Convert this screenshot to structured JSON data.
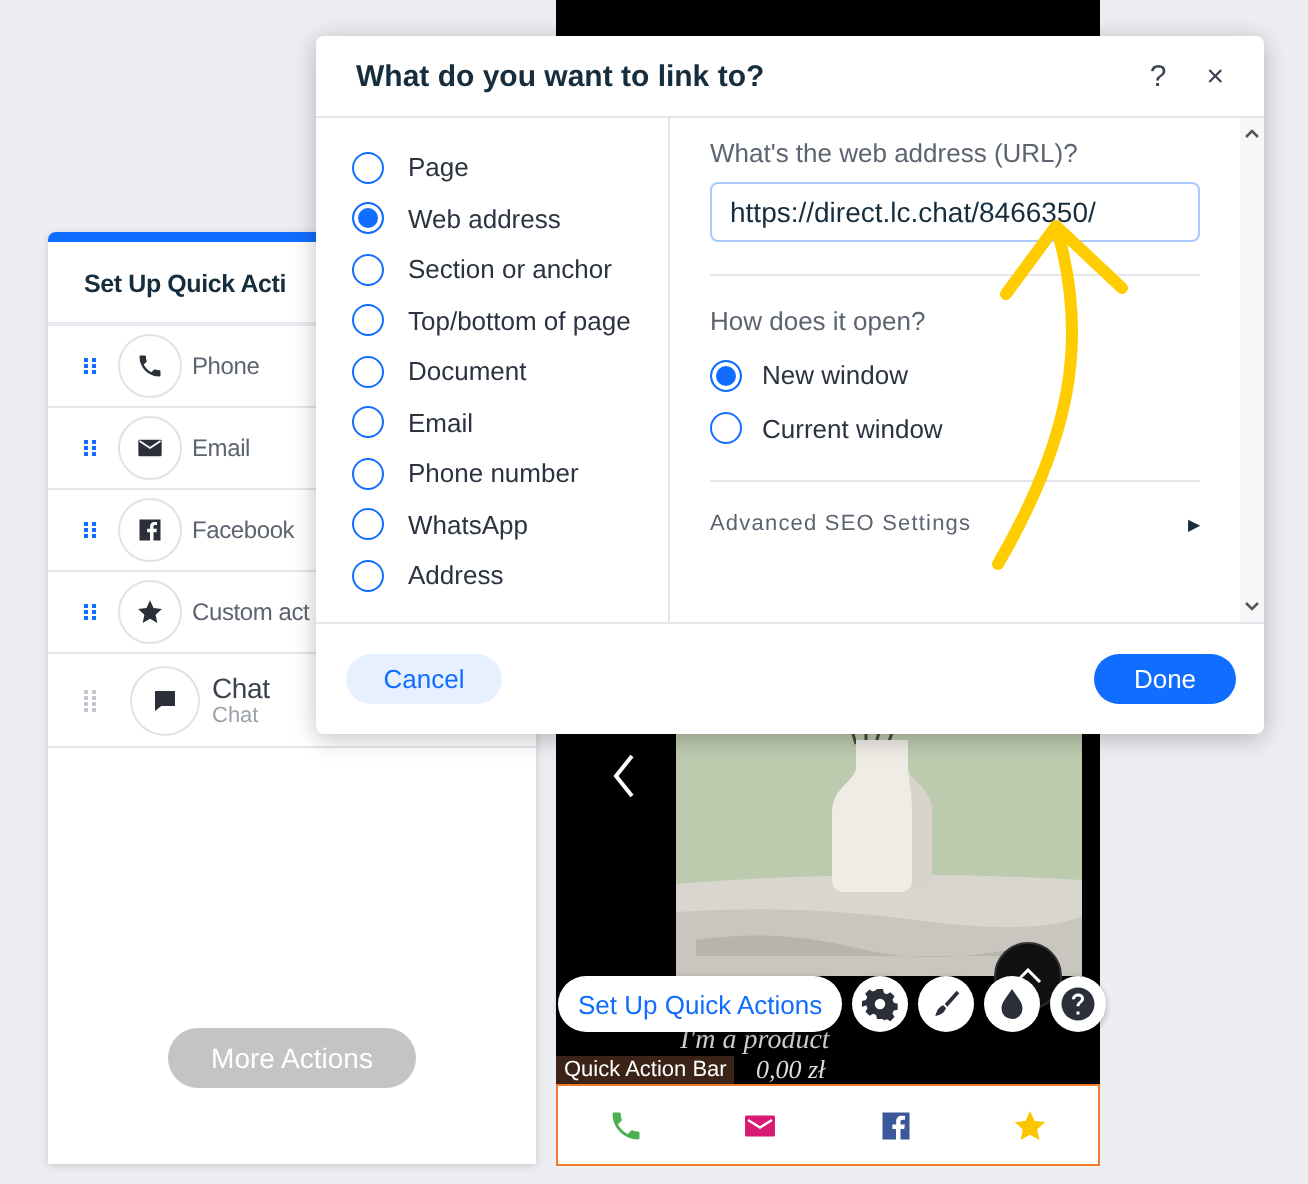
{
  "quick_actions_panel": {
    "title": "Set Up Quick Acti",
    "items": [
      {
        "kind": "phone",
        "label": "Phone",
        "active": true
      },
      {
        "kind": "email",
        "label": "Email",
        "active": true
      },
      {
        "kind": "facebook",
        "label": "Facebook",
        "active": true
      },
      {
        "kind": "star",
        "label": "Custom act",
        "active": true
      },
      {
        "kind": "chat",
        "label": "Chat",
        "subtitle": "Chat",
        "active": false
      }
    ],
    "more_button": {
      "label": "More Actions",
      "disabled": true
    }
  },
  "preview": {
    "product_title": "I'm a product",
    "price": "0,00 zł",
    "toolbar_button": "Set Up Quick Actions",
    "toolbar_icons": [
      {
        "kind": "gear"
      },
      {
        "kind": "brush"
      },
      {
        "kind": "drop"
      },
      {
        "kind": "help"
      }
    ],
    "bar_label": "Quick Action Bar",
    "bar_icons": [
      {
        "kind": "phone",
        "color": "#4caf50"
      },
      {
        "kind": "email",
        "color": "#d81b72"
      },
      {
        "kind": "facebook",
        "color": "#3b5998"
      },
      {
        "kind": "star",
        "color": "#fbc600"
      }
    ]
  },
  "dialog": {
    "title": "What do you want to link to?",
    "help": "?",
    "close": "×",
    "options": [
      {
        "label": "Page",
        "selected": false
      },
      {
        "label": "Web address",
        "selected": true
      },
      {
        "label": "Section or anchor",
        "selected": false
      },
      {
        "label": "Top/bottom of page",
        "selected": false
      },
      {
        "label": "Document",
        "selected": false
      },
      {
        "label": "Email",
        "selected": false
      },
      {
        "label": "Phone number",
        "selected": false
      },
      {
        "label": "WhatsApp",
        "selected": false
      },
      {
        "label": "Address",
        "selected": false
      }
    ],
    "url_label": "What's the web address (URL)?",
    "url_value": "https://direct.lc.chat/8466350/",
    "open_label": "How does it open?",
    "open_options": [
      {
        "label": "New window",
        "selected": true
      },
      {
        "label": "Current window",
        "selected": false
      }
    ],
    "advanced_label": "Advanced SEO Settings",
    "advanced_arrow": "▶",
    "cancel": "Cancel",
    "done": "Done"
  }
}
